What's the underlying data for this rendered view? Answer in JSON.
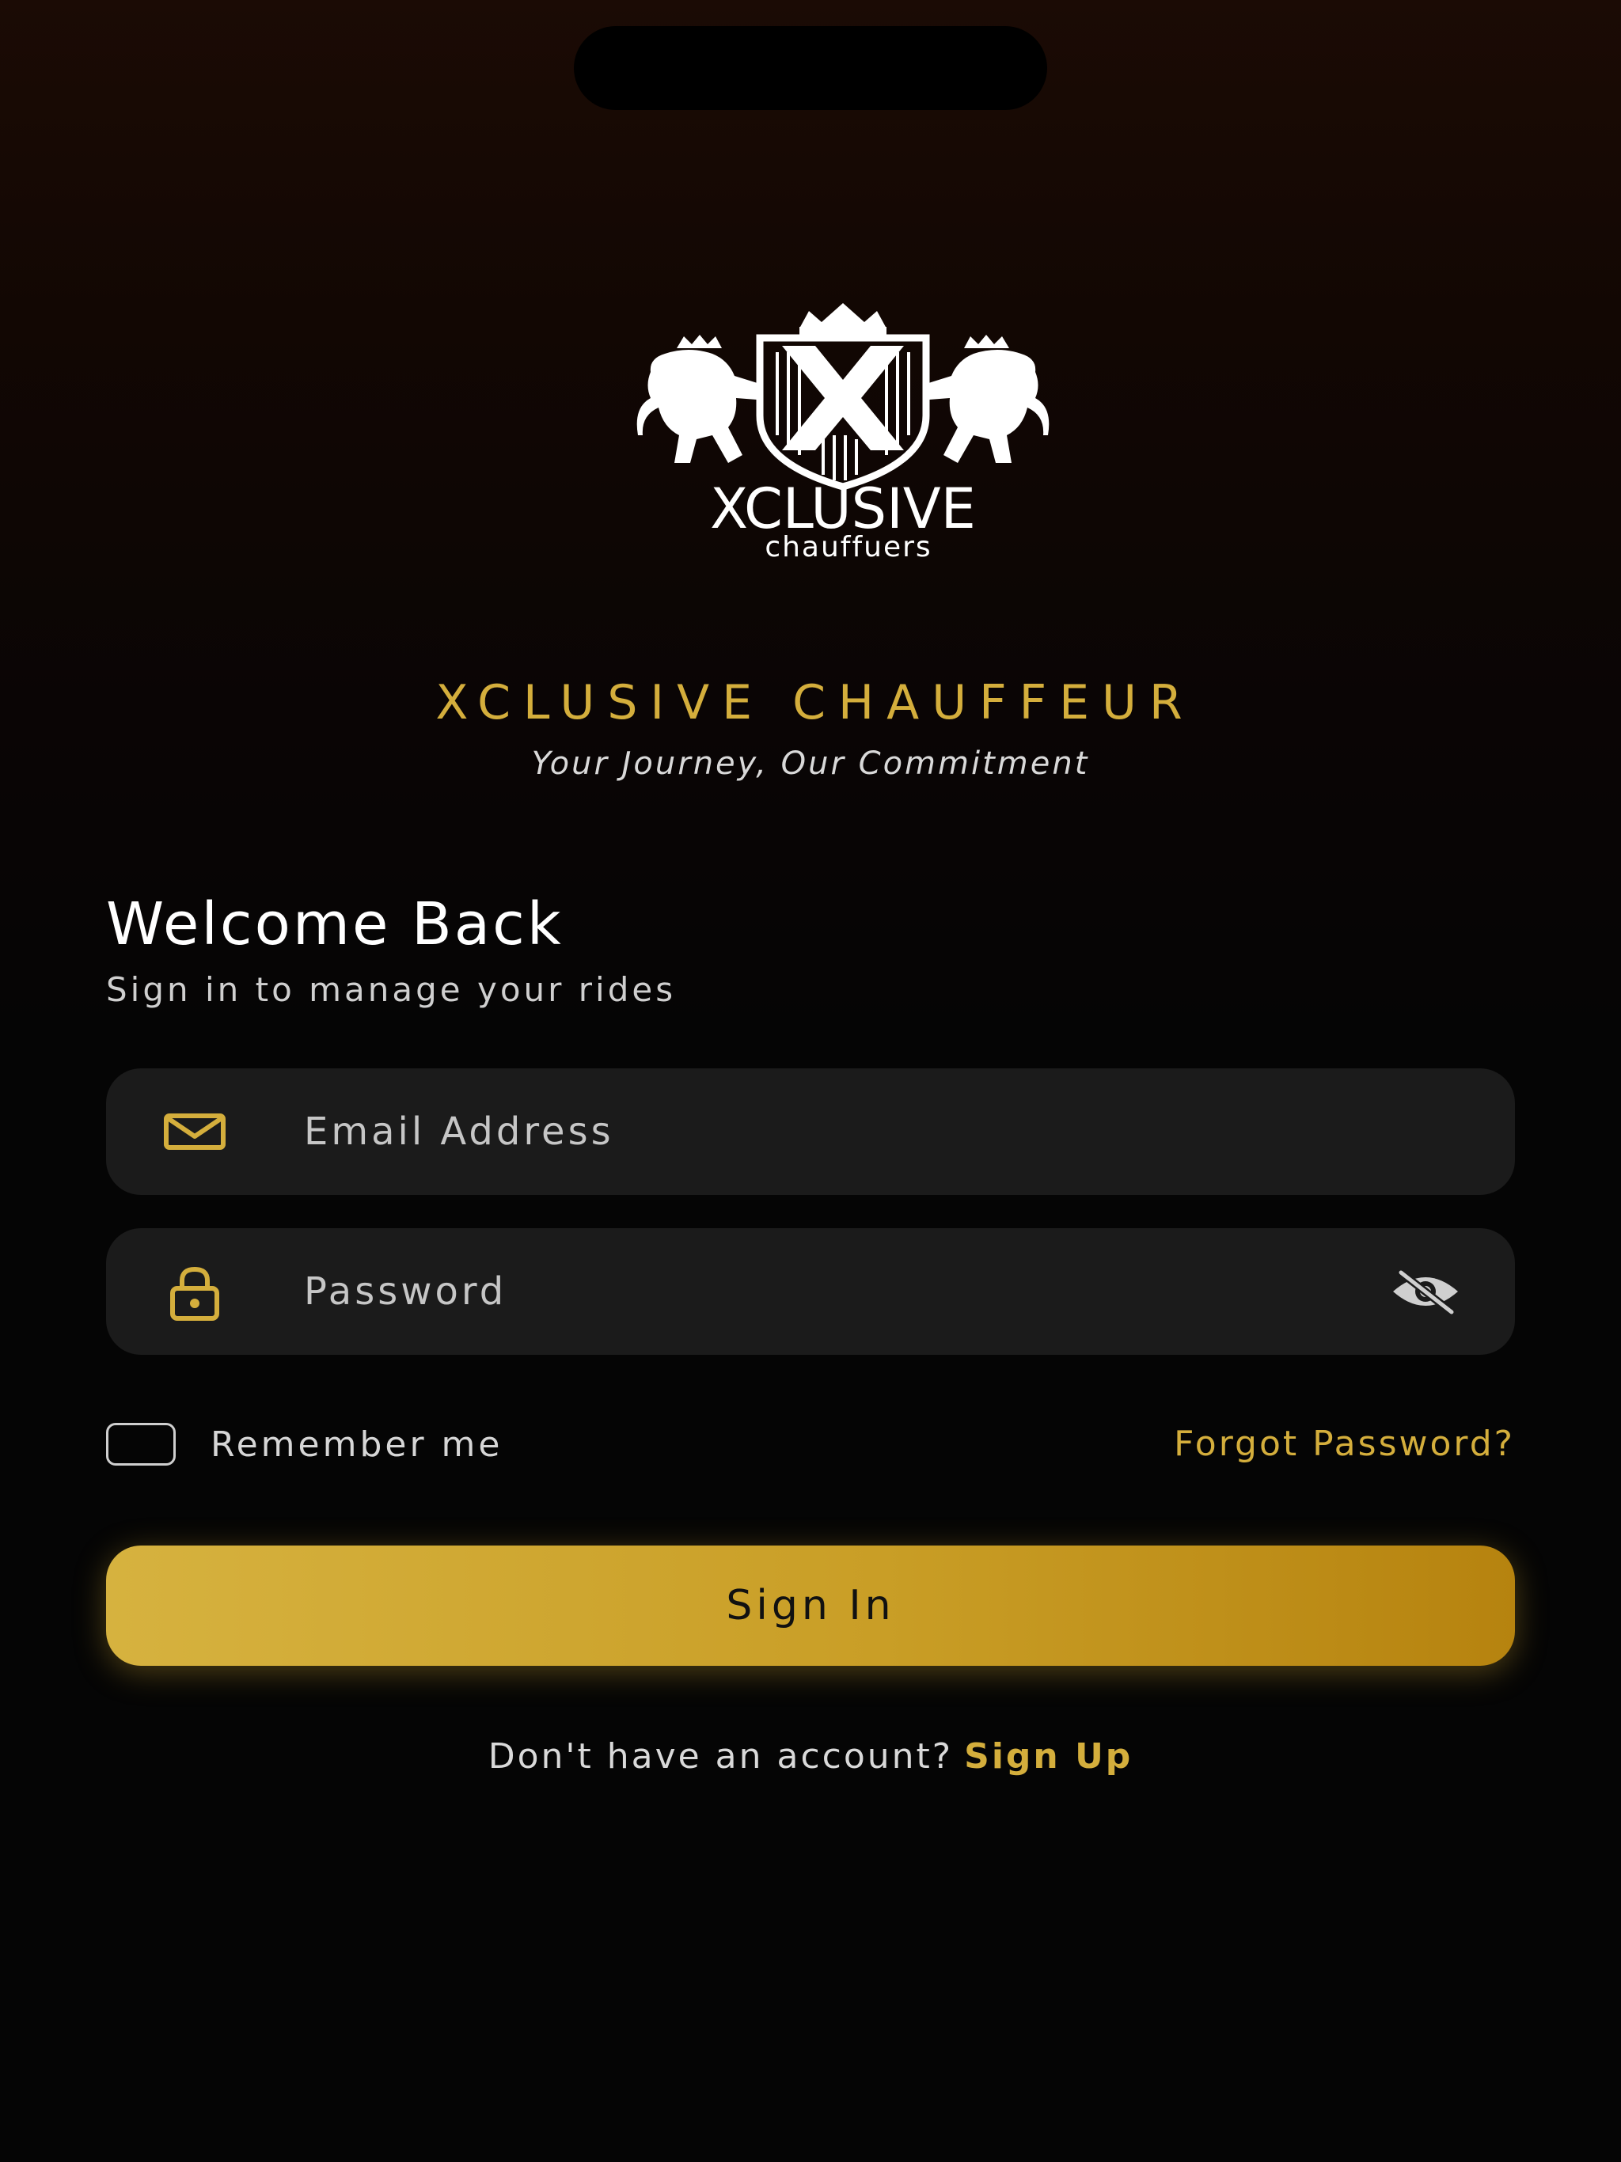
{
  "brand": {
    "logo_wordmark": "XCLUSIVE",
    "logo_subtext": "chauffuers",
    "title": "XCLUSIVE CHAUFFEUR",
    "tagline": "Your Journey, Our Commitment"
  },
  "login": {
    "heading": "Welcome Back",
    "subheading": "Sign in to manage your rides",
    "email": {
      "icon": "mail-icon",
      "placeholder": "Email Address",
      "value": ""
    },
    "password": {
      "icon": "lock-icon",
      "placeholder": "Password",
      "value": "",
      "toggle_icon": "eye-off-icon"
    },
    "remember_label": "Remember me",
    "remember_checked": false,
    "forgot_label": "Forgot Password?",
    "submit_label": "Sign In",
    "signup_prompt": "Don't have an account?",
    "signup_label": "Sign Up"
  },
  "colors": {
    "accent_gold": "#d4ae3c",
    "field_bg": "#1b1b1b",
    "background": "#050505"
  }
}
